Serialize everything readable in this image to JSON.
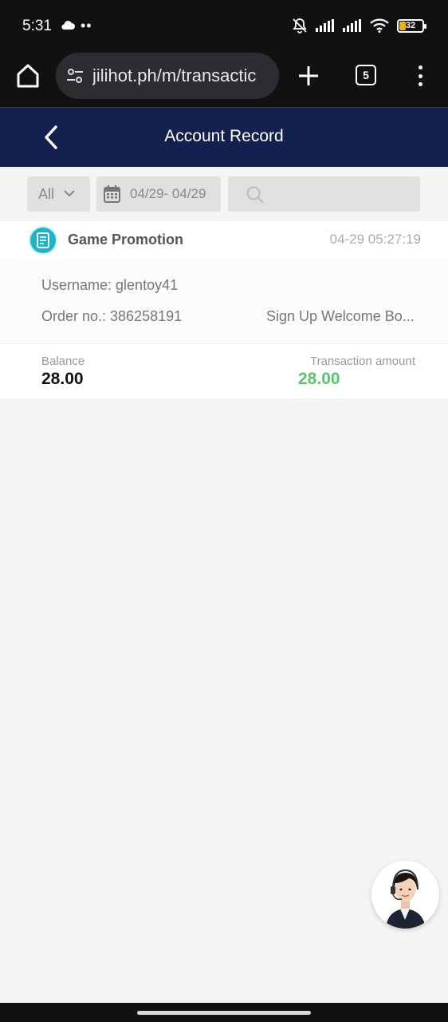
{
  "status_bar": {
    "time": "5:31",
    "battery": "32",
    "icons": [
      "cloud-icon",
      "more-dots-icon",
      "mute-bell-icon",
      "signal-icon",
      "signal-icon",
      "wifi-icon",
      "battery-icon"
    ],
    "battery_color": "#f0b400"
  },
  "browser": {
    "url": "jilihot.ph/m/transactic",
    "tab_count": "5",
    "icons": [
      "home-icon",
      "tune-icon",
      "plus-icon",
      "tabs-icon",
      "more-vert-icon"
    ]
  },
  "header": {
    "title": "Account Record",
    "background": "#142050"
  },
  "filters": {
    "type_value": "All",
    "date_range": "04/29- 04/29",
    "search_placeholder": ""
  },
  "records": [
    {
      "type": "Game Promotion",
      "time": "04-29 05:27:19",
      "username_line": "Username: glentoy41",
      "order_line": "Order no.: 386258191",
      "description": "Sign Up Welcome Bo...",
      "balance_label": "Balance",
      "balance": "28.00",
      "amount_label": "Transaction amount",
      "amount": "28.00",
      "amount_color": "#5ac46a",
      "icon": "promotion-receipt-icon"
    }
  ],
  "support": {
    "icon": "customer-service-avatar"
  }
}
